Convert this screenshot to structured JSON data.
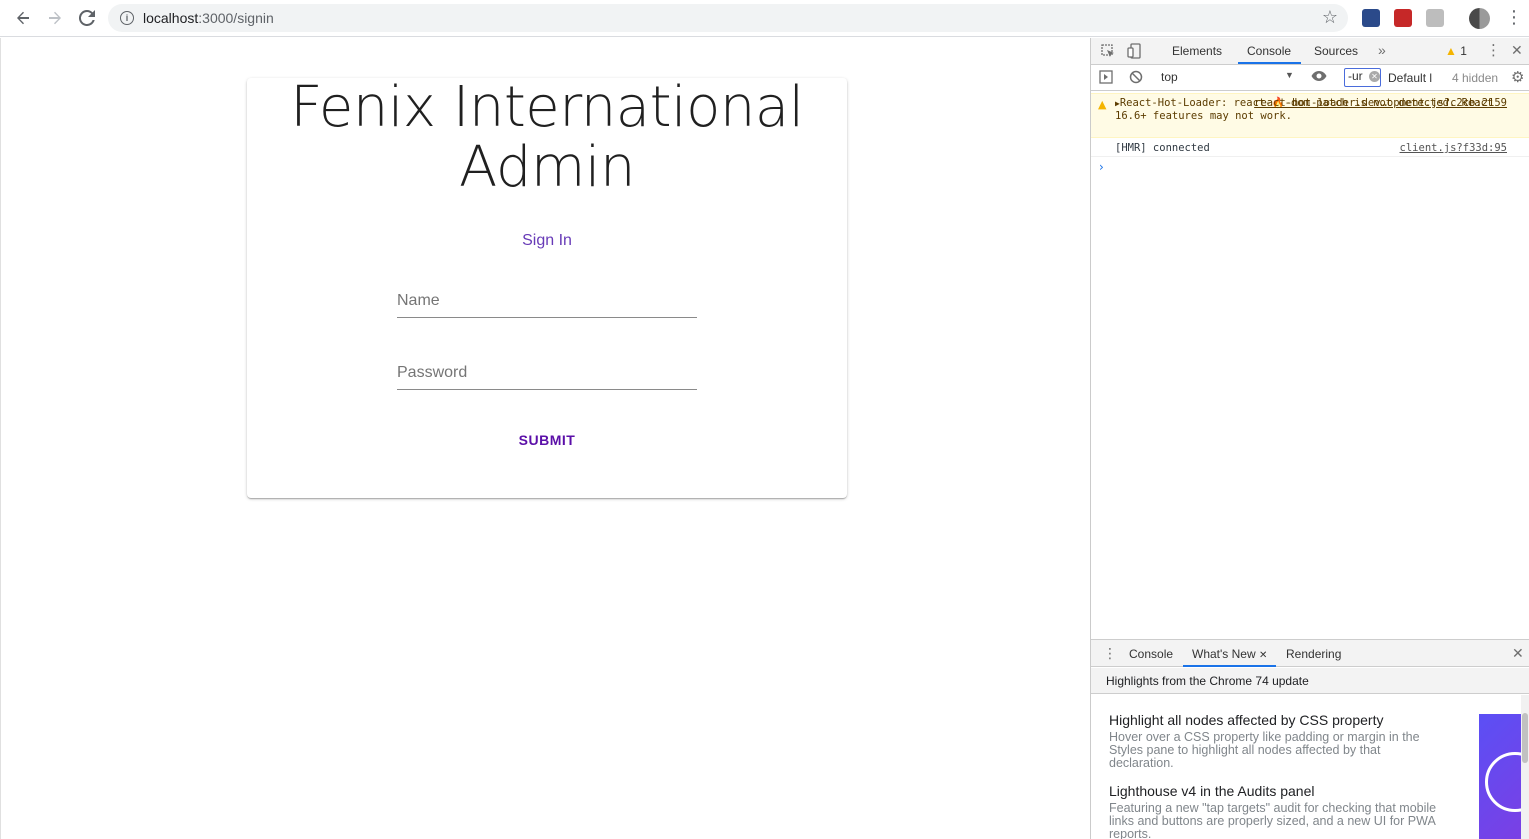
{
  "browser": {
    "url_host": "localhost",
    "url_path": ":3000/signin",
    "info_icon": "info-icon"
  },
  "page": {
    "title": "Fenix International Admin",
    "signin_label": "Sign In",
    "name_placeholder": "Name",
    "password_placeholder": "Password",
    "submit_label": "SUBMIT",
    "accent_color": "#673ab7"
  },
  "devtools": {
    "tabs": [
      "Elements",
      "Console",
      "Sources"
    ],
    "active_tab": "Console",
    "warning_count": "1",
    "context": "top",
    "filter_value": "-ur",
    "levels": "Default l",
    "hidden": "4 hidden",
    "console": {
      "warning": {
        "text": "React-Hot-Loader: react-🔥-dom patch is not detected. React 16.6+ features may not work.",
        "source": "react-hot-loader.dev…opment.js?c2cb:2159"
      },
      "log": {
        "text": "[HMR] connected",
        "source": "client.js?f33d:95"
      },
      "prompt": "›"
    },
    "drawer": {
      "tabs": [
        "Console",
        "What's New",
        "Rendering"
      ],
      "active_tab": "What's New",
      "header": "Highlights from the Chrome 74 update",
      "items": [
        {
          "title": "Highlight all nodes affected by CSS property",
          "desc": "Hover over a CSS property like padding or margin in the Styles pane to highlight all nodes affected by that declaration."
        },
        {
          "title": "Lighthouse v4 in the Audits panel",
          "desc": "Featuring a new \"tap targets\" audit for checking that mobile links and buttons are properly sized, and a new UI for PWA reports."
        }
      ]
    }
  }
}
